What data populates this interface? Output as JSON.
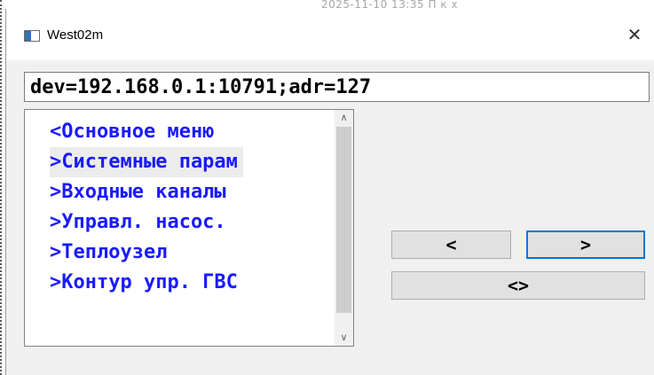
{
  "background": {
    "marks": "2025-11-10 13:35      П                     к        х"
  },
  "window": {
    "title": "West02m",
    "close_glyph": "✕"
  },
  "address": {
    "value": "dev=192.168.0.1:10791;adr=127"
  },
  "menu": {
    "items": [
      {
        "label": "<Основное меню",
        "selected": false
      },
      {
        "label": ">Системные парам",
        "selected": true
      },
      {
        "label": ">Входные каналы",
        "selected": false
      },
      {
        "label": ">Управл. насос.",
        "selected": false
      },
      {
        "label": ">Теплоузел",
        "selected": false
      },
      {
        "label": ">Контур упр. ГВС",
        "selected": false
      }
    ],
    "scroll_up_glyph": "∧",
    "scroll_down_glyph": "∨"
  },
  "buttons": {
    "prev_label": "<",
    "next_label": ">",
    "both_label": "<>"
  },
  "colors": {
    "item_text": "#1a1aff",
    "focus_border": "#0078d7"
  }
}
